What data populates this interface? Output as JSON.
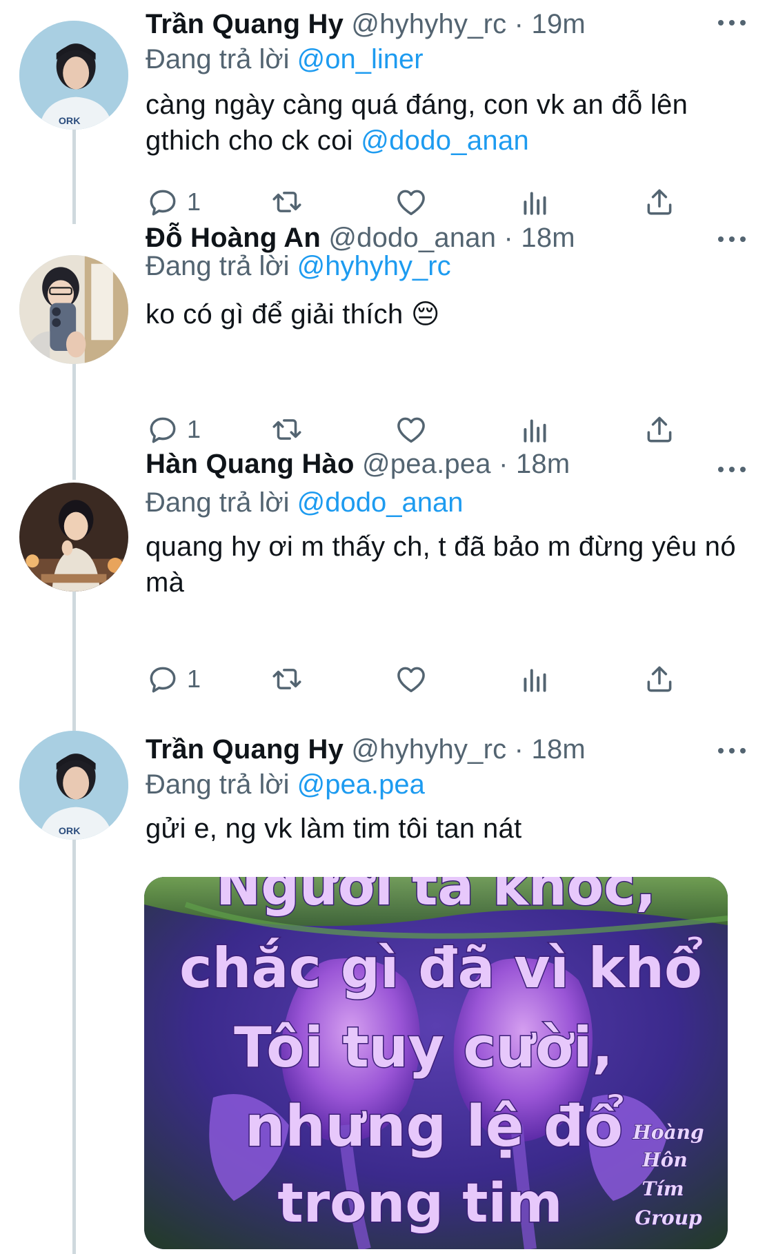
{
  "tweets": [
    {
      "name": "Trần Quang Hy",
      "handle": "@hyhyhy_rc",
      "separator": "·",
      "time": "19m",
      "reply_prefix": "Đang trả lời",
      "reply_to": "@on_liner",
      "text_parts": [
        "càng ngày càng quá đáng, con vk an đỗ lên gthich cho ck coi ",
        "@dodo_anan"
      ],
      "reply_count": "1",
      "avatar_icon": "avatar-photo"
    },
    {
      "name": "Đỗ Hoàng An",
      "handle": "@dodo_anan",
      "separator": "·",
      "time": "18m",
      "reply_prefix": "Đang trả lời",
      "reply_to": "@hyhyhy_rc",
      "text": "ko có gì để giải thích 😔",
      "reply_count": "1",
      "avatar_icon": "avatar-photo"
    },
    {
      "name": "Hàn Quang Hào",
      "handle": "@pea.pea",
      "separator": "·",
      "time": "18m",
      "reply_prefix": "Đang trả lời",
      "reply_to": "@dodo_anan",
      "text": "quang hy ơi m thấy ch, t đã bảo m đừng yêu nó mà",
      "reply_count": "1",
      "avatar_icon": "avatar-photo"
    },
    {
      "name": "Trần Quang Hy",
      "handle": "@hyhyhy_rc",
      "separator": "·",
      "time": "18m",
      "reply_prefix": "Đang trả lời",
      "reply_to": "@pea.pea",
      "text": "gửi e, ng vk làm tim tôi tan nát",
      "avatar_icon": "avatar-photo"
    }
  ],
  "media": {
    "lines": [
      "Người ta khóc,",
      "chắc gì đã vì khổ",
      "Tôi tuy cười,",
      "nhưng lệ đổ",
      "trong tim"
    ],
    "signature": [
      "Hoàng",
      "Hôn",
      "Tím",
      "Group"
    ]
  },
  "icons": {
    "reply": "reply-icon",
    "retweet": "retweet-icon",
    "like": "heart-icon",
    "views": "analytics-icon",
    "share": "share-icon",
    "more": "more-icon"
  },
  "colors": {
    "text": "#0f1419",
    "secondary": "#536471",
    "link": "#1d9bf0",
    "thread_line": "#cfd9de"
  }
}
